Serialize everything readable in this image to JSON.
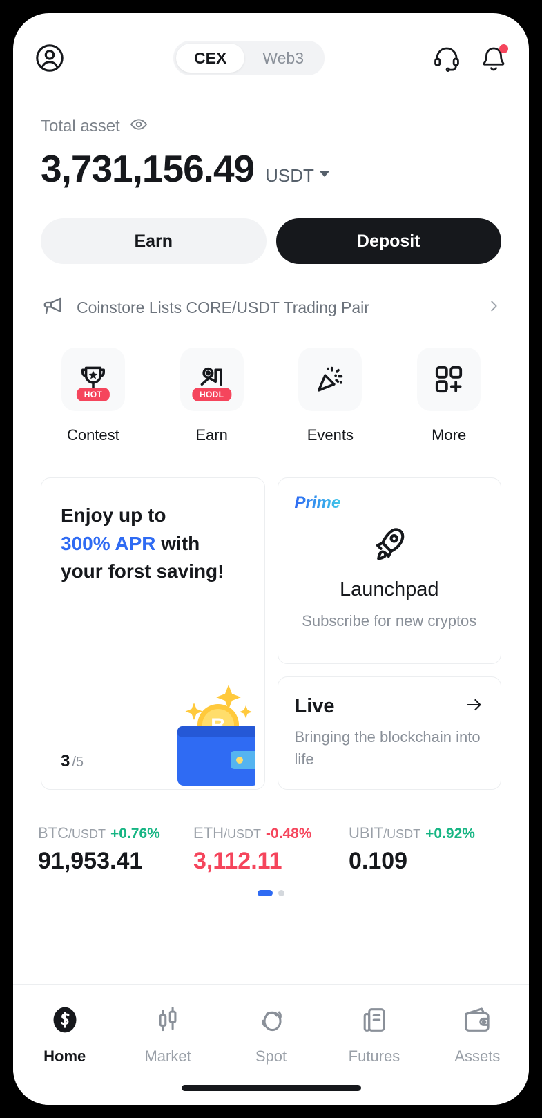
{
  "header": {
    "avatar_icon": "user-circle-icon",
    "tabs": [
      {
        "label": "CEX",
        "active": true
      },
      {
        "label": "Web3",
        "active": false
      }
    ],
    "support_icon": "headset-icon",
    "notification_icon": "bell-icon",
    "has_notification_dot": true
  },
  "balance": {
    "label": "Total asset",
    "eye_icon": "eye-icon",
    "amount": "3,731,156.49",
    "currency": "USDT",
    "caret_icon": "caret-down-icon"
  },
  "actions": {
    "earn_label": "Earn",
    "deposit_label": "Deposit"
  },
  "announcement": {
    "icon": "megaphone-icon",
    "text": "Coinstore Lists CORE/USDT Trading Pair",
    "chevron_icon": "chevron-right-icon"
  },
  "quick_links": [
    {
      "label": "Contest",
      "icon": "trophy-icon",
      "badge": "HOT"
    },
    {
      "label": "Earn",
      "icon": "hodl-chart-icon",
      "badge": "HODL"
    },
    {
      "label": "Events",
      "icon": "confetti-icon",
      "badge": ""
    },
    {
      "label": "More",
      "icon": "grid-plus-icon",
      "badge": ""
    }
  ],
  "promo_card": {
    "line1": "Enjoy up to",
    "highlight": "300% APR",
    "line2_rest": " with",
    "line3": "your forst saving!",
    "highlight_color": "#2f6bf3",
    "pager_current": "3",
    "pager_total": "/5",
    "art": "wallet-bitcoin-illustration"
  },
  "launchpad_card": {
    "tag": "Prime",
    "icon": "rocket-icon",
    "title": "Launchpad",
    "subtitle": "Subscribe for new cryptos"
  },
  "live_card": {
    "title": "Live",
    "arrow_icon": "arrow-right-icon",
    "subtitle": "Bringing the blockchain into life"
  },
  "tickers": [
    {
      "base": "BTC",
      "quote": "/USDT",
      "change": "+0.76%",
      "direction": "up",
      "price": "91,953.41"
    },
    {
      "base": "ETH",
      "quote": "/USDT",
      "change": "-0.48%",
      "direction": "down",
      "price": "3,112.11"
    },
    {
      "base": "UBIT",
      "quote": "/USDT",
      "change": "+0.92%",
      "direction": "up",
      "price": "0.109"
    }
  ],
  "carousel": {
    "total": 2,
    "active_index": 0,
    "active_color": "#2f6bf3"
  },
  "bottom_nav": [
    {
      "label": "Home",
      "icon": "coinstore-logo-icon",
      "active": true
    },
    {
      "label": "Market",
      "icon": "candlestick-icon",
      "active": false
    },
    {
      "label": "Spot",
      "icon": "spot-rings-icon",
      "active": false
    },
    {
      "label": "Futures",
      "icon": "document-icon",
      "active": false
    },
    {
      "label": "Assets",
      "icon": "wallet-icon",
      "active": false
    }
  ]
}
